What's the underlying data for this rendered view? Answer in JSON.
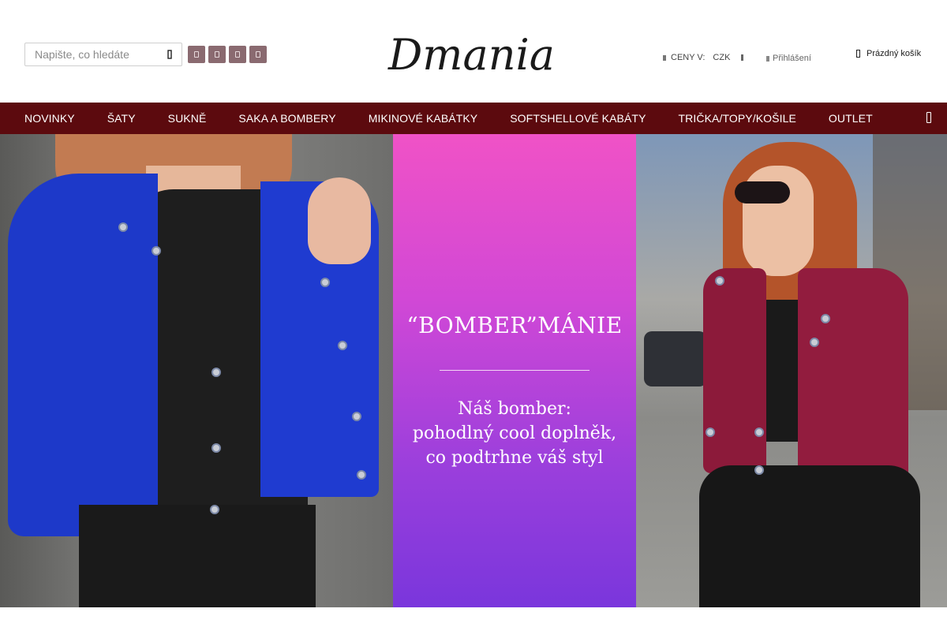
{
  "search": {
    "placeholder": "Napište, co hledáte",
    "icon": "search-icon"
  },
  "socials": [
    {
      "icon": "facebook-icon"
    },
    {
      "icon": "instagram-icon"
    },
    {
      "icon": "youtube-icon"
    },
    {
      "icon": "pinterest-icon"
    }
  ],
  "logo": {
    "text": "Dmania"
  },
  "header": {
    "prices_label": "CENY V:",
    "currency": "CZK",
    "login_label": "Přihlášení",
    "cart_label": "Prázdný košík"
  },
  "nav": {
    "items": [
      "NOVINKY",
      "ŠATY",
      "SUKNĚ",
      "SAKA A BOMBERY",
      "MIKINOVÉ KABÁTKY",
      "SOFTSHELLOVÉ KABÁTY",
      "TRIČKA/TOPY/KOŠILE",
      "OUTLET"
    ],
    "search_icon": "search-icon"
  },
  "hero": {
    "title": "“BOMBER”MÁNIE",
    "line1": "Náš bomber:",
    "line2": "pohodlný cool doplněk,",
    "line3": "co podtrhne váš styl"
  },
  "colors": {
    "nav_bg": "#5c0a0e",
    "social_bg": "#8a6a70",
    "promo_top": "#f052c6",
    "promo_bottom": "#7a36dc"
  }
}
